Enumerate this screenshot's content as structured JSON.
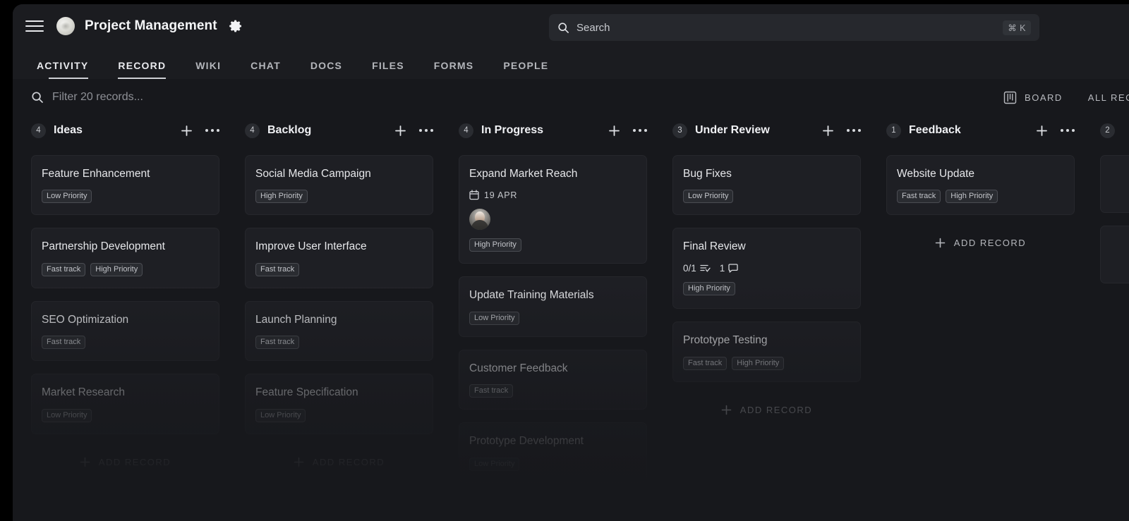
{
  "window": {
    "app_title": "Project Management"
  },
  "topbar": {
    "menu_icon": "hamburger-icon",
    "logo_icon": "workspace-avatar",
    "settings_icon": "gear-icon",
    "search": {
      "placeholder": "Search",
      "value": "",
      "icon": "search-icon",
      "shortcut": "⌘ K"
    }
  },
  "tabs": [
    {
      "label": "ACTIVITY",
      "active": false
    },
    {
      "label": "RECORD",
      "active": true
    },
    {
      "label": "WIKI",
      "active": false
    },
    {
      "label": "CHAT",
      "active": false
    },
    {
      "label": "DOCS",
      "active": false
    },
    {
      "label": "FILES",
      "active": false
    },
    {
      "label": "FORMS",
      "active": false
    },
    {
      "label": "PEOPLE",
      "active": false
    }
  ],
  "filterbar": {
    "icon": "search-icon",
    "placeholder": "Filter 20 records...",
    "value": "",
    "views": [
      {
        "label": "BOARD",
        "icon": "board-icon"
      },
      {
        "label": "ALL REC",
        "icon": ""
      }
    ]
  },
  "board": {
    "add_record_label": "ADD RECORD",
    "columns": [
      {
        "title": "Ideas",
        "count": "4",
        "cards": [
          {
            "title": "Feature Enhancement",
            "tags": [
              "Low Priority"
            ]
          },
          {
            "title": "Partnership Development",
            "tags": [
              "Fast track",
              "High Priority"
            ]
          },
          {
            "title": "SEO Optimization",
            "tags": [
              "Fast track"
            ]
          },
          {
            "title": "Market Research",
            "tags": [
              "Low Priority"
            ]
          }
        ]
      },
      {
        "title": "Backlog",
        "count": "4",
        "cards": [
          {
            "title": "Social Media Campaign",
            "tags": [
              "High Priority"
            ]
          },
          {
            "title": "Improve User Interface",
            "tags": [
              "Fast track"
            ]
          },
          {
            "title": "Launch Planning",
            "tags": [
              "Fast track"
            ]
          },
          {
            "title": "Feature Specification",
            "tags": [
              "Low Priority"
            ]
          }
        ]
      },
      {
        "title": "In Progress",
        "count": "4",
        "cards": [
          {
            "title": "Expand Market Reach",
            "date": "19 APR",
            "has_avatar": true,
            "tags": [
              "High Priority"
            ]
          },
          {
            "title": "Update Training Materials",
            "tags": [
              "Low Priority"
            ]
          },
          {
            "title": "Customer Feedback",
            "tags": [
              "Fast track"
            ]
          },
          {
            "title": "Prototype Development",
            "tags": [
              "Low Priority"
            ]
          }
        ]
      },
      {
        "title": "Under Review",
        "count": "3",
        "cards": [
          {
            "title": "Bug Fixes",
            "tags": [
              "Low Priority"
            ]
          },
          {
            "title": "Final Review",
            "checklist": "0/1",
            "comments": "1",
            "tags": [
              "High Priority"
            ]
          },
          {
            "title": "Prototype Testing",
            "tags": [
              "Fast track",
              "High Priority"
            ]
          }
        ]
      },
      {
        "title": "Feedback",
        "count": "1",
        "cards": [
          {
            "title": "Website Update",
            "tags": [
              "Fast track",
              "High Priority"
            ]
          }
        ]
      }
    ],
    "peek_column": {
      "count": "2"
    }
  },
  "colors": {
    "page_bg": "#17181c",
    "chrome_bg": "#1b1c20",
    "card_bg": "#1e1f24",
    "text_primary": "#f0f1f4",
    "text_muted": "#b4b6bb"
  }
}
